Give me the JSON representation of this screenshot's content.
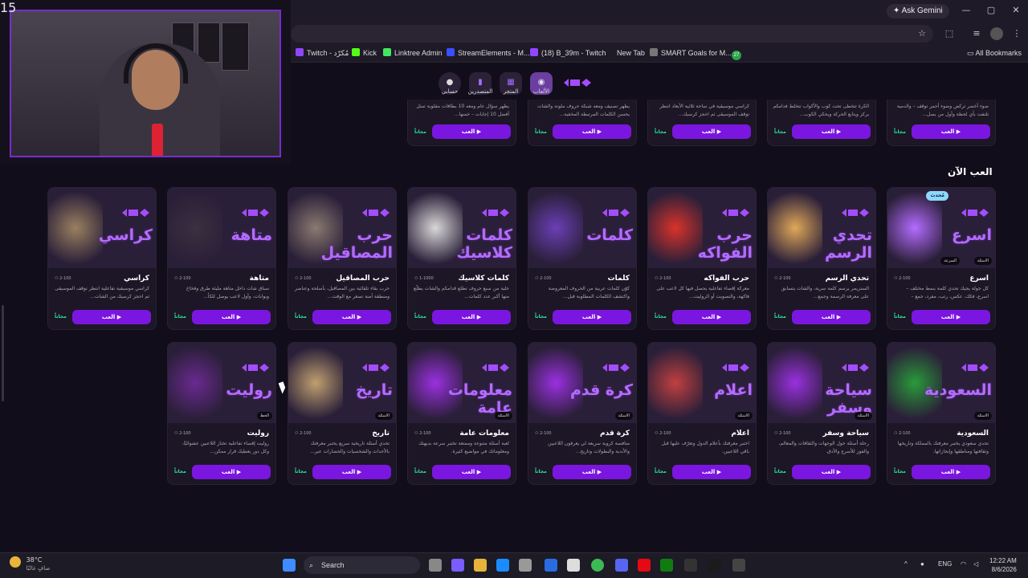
{
  "browser": {
    "gemini_label": "Ask Gemini",
    "bookmarks": [
      {
        "label": "Twitch - مُكرّد",
        "color": "#9146ff"
      },
      {
        "label": "Kick",
        "color": "#53fc18"
      },
      {
        "label": "Linktree Admin",
        "color": "#43e660"
      },
      {
        "label": "StreamElements - M...",
        "color": "#3a4fff"
      },
      {
        "label": "(18) B_39m - Twitch",
        "color": "#9146ff"
      },
      {
        "label": "New Tab",
        "color": "#1f1a27"
      },
      {
        "label": "SMART Goals for M...",
        "color": "#777777"
      },
      {
        "label": "27",
        "color": "#2aa34a"
      }
    ],
    "all_bookmarks": "All Bookmarks"
  },
  "site_nav": {
    "items": [
      {
        "label": "الألعاب"
      },
      {
        "label": "المتجر"
      },
      {
        "label": "المتصدرين"
      },
      {
        "label": "حسابي"
      }
    ]
  },
  "top_row": [
    {
      "desc": "ضوء أخضر تركض وضوء أحمر توقف – والدمية تلتفت بأي لحظة وأول من يصل...",
      "free": "مجاناً",
      "play": "العب"
    },
    {
      "desc": "الكرة تتخطى تحت كوب والأكواب تتخلط فدامكم يركز ويتابع الحركة ويحكي الكوب...",
      "free": "مجاناً",
      "play": "العب"
    },
    {
      "desc": "كراسي موسيقية في ساحة ثلاثية الأبعاد انتظر توقف الموسيقى ثم احجز كرسيك...",
      "free": "مجاناً",
      "play": "العب"
    },
    {
      "desc": "يظهر تصنيف ومعه شبكة حروف ملونة والشات يحسن الكلمات المرتبطة المخفية...",
      "free": "مجاناً",
      "play": "العب"
    },
    {
      "desc": "يظهر سؤال عام ومعه 10 بطاقات مقلوبة تمثل أفضل 10 إجابات – خمنها...",
      "free": "مجاناً",
      "play": "العب"
    }
  ],
  "section": {
    "title": "العب الآن",
    "counter": "15"
  },
  "row1": [
    {
      "thumb": "اسرع",
      "title": "اسرع",
      "players": "2-100",
      "desc": "كل جولة يجيك تحدي كلمة بنمط مختلف – اسرع، فكك، عكس، رتب، مفرد، جمع –",
      "free": "مجاناً",
      "play": "العب",
      "tag": "الاسئلة",
      "tag2": "السرعة",
      "badge": "مُحدث",
      "accent": "#b46cff"
    },
    {
      "thumb": "تحدي الرسم",
      "title": "تحدي الرسم",
      "players": "2-100",
      "desc": "الستريمر يرسم كلمة سرية، والشات يتسابق على معرفة الرسمة وجمع...",
      "free": "مجاناً",
      "play": "العب",
      "accent": "#e0a85a"
    },
    {
      "thumb": "حرب الفواكه",
      "title": "حرب الفواكه",
      "players": "2-100",
      "desc": "معركة إقصاء تفاعلية يحصل فيها كل لاعب على فاكهة، والتصويت أو الروليت...",
      "free": "مجاناً",
      "play": "العب",
      "accent": "#d8332b"
    },
    {
      "thumb": "كلمات",
      "title": "كلمات",
      "players": "2-100",
      "desc": "كوّن كلمات عربية من الحروف المعروضة واكتشف الكلمات المطلوبة قبل...",
      "free": "مجاناً",
      "play": "العب",
      "accent": "#6a3fb5"
    },
    {
      "thumb": "كلمات كلاسيك",
      "title": "كلمات كلاسيك",
      "players": "1-1000",
      "desc": "خلية من سبع حروف تطلع قدامكم والشات يطلّع منها أكبر عدد كلمات...",
      "free": "مجاناً",
      "play": "العب",
      "accent": "#d8d8d8"
    },
    {
      "thumb": "حرب المصاقيل",
      "title": "حرب المصاقيل",
      "players": "2-100",
      "desc": "حرب بقاء تلقائية بين المصاقيل، بأسلحة وعناصر ومنطقة آمنة تصغر مع الوقت...",
      "free": "مجاناً",
      "play": "العب",
      "accent": "#8a7a70"
    },
    {
      "thumb": "متاهة",
      "title": "متاهة",
      "players": "2-100",
      "desc": "سباق شات داخل متاهة مليئة طرق وفخاخ وبوابات، وأول لاعب يوصل للكأ...",
      "free": "مجاناً",
      "play": "العب",
      "accent": "#3a3040"
    },
    {
      "thumb": "كراسي",
      "title": "كراسي",
      "players": "2-100",
      "desc": "كراسي موسيقية تفاعلية انتظر توقف الموسيقى ثم احجز كرسيك من الشات...",
      "free": "مجاناً",
      "play": "العب",
      "accent": "#9a8060"
    }
  ],
  "row2": [
    {
      "thumb": "السعودية",
      "title": "السعودية",
      "players": "2-100",
      "desc": "تحدي سعودي يختبر معرفتك بالمملكة وتاريخها وثقافتها ومناطقها وإنجازاتها.",
      "free": "مجاناً",
      "play": "العب",
      "tag": "الاسئلة",
      "accent": "#2a9a3a"
    },
    {
      "thumb": "سياحة وسفر",
      "title": "سياحة وسفر",
      "players": "2-100",
      "desc": "رحلة أسئلة حول الوجهات والثقافات والمعالم، والفوز للأسرع والأدق.",
      "free": "مجاناً",
      "play": "العب",
      "tag": "الاسئلة",
      "accent": "#9a30e0"
    },
    {
      "thumb": "اعلام",
      "title": "اعلام",
      "players": "2-100",
      "desc": "اختبر معرفتك بأعلام الدول وتعرّف عليها قبل باقي اللاعبين.",
      "free": "مجاناً",
      "play": "العب",
      "tag": "الاسئلة",
      "accent": "#c04040"
    },
    {
      "thumb": "كرة قدم",
      "title": "كرة قدم",
      "players": "2-100",
      "desc": "منافسة كروية سريعة لي يعرفون اللاعبين والأندية والبطولات وتاريخ...",
      "free": "مجاناً",
      "play": "العب",
      "tag": "الاسئلة",
      "accent": "#9a30e0"
    },
    {
      "thumb": "معلومات عامة",
      "title": "معلومات عامة",
      "players": "2-100",
      "desc": "لعبة أسئلة متنوعة وممتعة تختبر سرعة بديهتك ومعلوماتك في مواضيع كثيرة.",
      "free": "مجاناً",
      "play": "العب",
      "tag": "الاسئلة",
      "accent": "#9a30e0"
    },
    {
      "thumb": "تاريخ",
      "title": "تاريخ",
      "players": "2-100",
      "desc": "تحدي أسئلة تاريخية سريع يختبر معرفتك بالأحداث والشخصيات والحضارات عبر...",
      "free": "مجاناً",
      "play": "العب",
      "tag": "الاسئلة",
      "accent": "#c0a070"
    },
    {
      "thumb": "روليت",
      "title": "روليت",
      "players": "2-100",
      "desc": "روليت إقصاء تفاعلية تختار اللاعبين عشوائيًا، وكل دور يعطيك قرار ممكن...",
      "free": "مجاناً",
      "play": "العب",
      "tag": "الحظ",
      "accent": "#6a2a90"
    }
  ],
  "taskbar": {
    "weather_temp": "38°C",
    "weather_desc": "صافٍ غالبًا",
    "search": "Search",
    "lang": "ENG",
    "time": "12:22 AM",
    "date": "8/6/2026"
  }
}
